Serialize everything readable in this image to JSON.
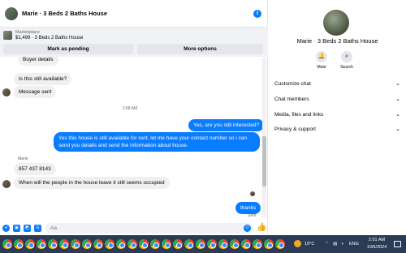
{
  "chat": {
    "header_title": "Marie · 3 Beds 2 Baths House",
    "info_icon": "info-icon",
    "marketplace_label": "Marketplace",
    "listing": "$1,499 · 3 Beds 2 Baths House",
    "pending_button": "Mark as pending",
    "more_options_button": "More options"
  },
  "messages": {
    "partial_top": "Buyer details",
    "m1": "Is this still available?",
    "m2": "Message sent",
    "time": "1:58 AM",
    "m3": "Yes, are you still interested?",
    "m4": "Yes this house is still available for rent, let me have your contact number so i can send you details and send the information about house.",
    "sender": "Marie",
    "m5": "857 437 8143",
    "m6": "When will the people in the house leave it still seems occupied",
    "m7": "thanks",
    "status": "Sent"
  },
  "composer": {
    "placeholder": "Aa"
  },
  "side": {
    "title": "Marie · 3 Beds 2 Baths House",
    "mute_label": "Mute",
    "search_label": "Search",
    "menu": [
      "Customize chat",
      "Chat members",
      "Media, files and links",
      "Privacy & support"
    ]
  },
  "taskbar": {
    "temperature": "19°C",
    "language": "ENG",
    "time": "2:01 AM",
    "date": "10/5/2024"
  },
  "colors": {
    "accent": "#0a7cff",
    "taskbar": "#2b3a55"
  }
}
